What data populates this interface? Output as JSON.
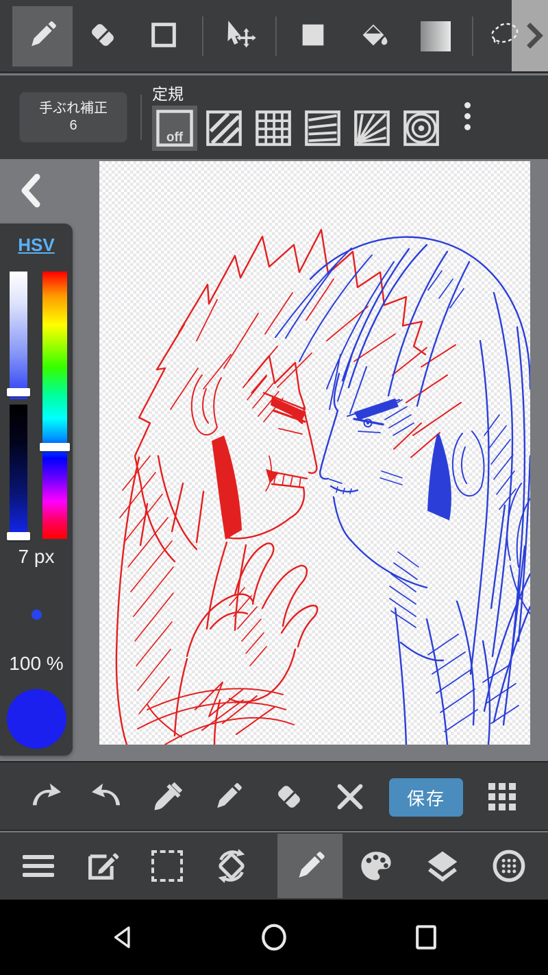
{
  "colors": {
    "toolbar_bg": "#3b3c3e",
    "workspace_bg": "#797a7e",
    "selected_tool_bg": "#5f6062",
    "icon": "#dcdcdc",
    "save_button": "#4a8cbd",
    "hsv_label_blue": "#5db2f5",
    "current_color": "#1b20ee",
    "sketch_red": "#e32020",
    "sketch_blue": "#2b3fd8"
  },
  "top_toolbar": {
    "tools": [
      "pen",
      "eraser",
      "shape-rectangle",
      "transform-move",
      "fill-rectangle",
      "bucket-fill",
      "gradient",
      "lasso"
    ],
    "selected_tool": "pen"
  },
  "ruler_row": {
    "stabilization_label": "手ぶれ補正",
    "stabilization_value": "6",
    "ruler_label": "定規",
    "ruler_off_label": "off",
    "rulers": [
      "off",
      "parallel-lines",
      "grid",
      "horizontal-lines",
      "radial-rays",
      "concentric-circles"
    ],
    "selected_ruler": "off"
  },
  "color_panel": {
    "mode_label": "HSV",
    "brush_size": "7 px",
    "opacity": "100 %"
  },
  "action_bar": {
    "icons": [
      "undo",
      "redo",
      "eyedropper",
      "pen",
      "eraser",
      "clear",
      "save",
      "menu-grid"
    ],
    "save_label": "保存"
  },
  "main_bar": {
    "icons": [
      "menu",
      "edit",
      "select",
      "rotate",
      "pen",
      "palette",
      "layers",
      "material"
    ],
    "selected": "pen"
  },
  "android_nav": {
    "icons": [
      "back",
      "home",
      "recents"
    ]
  },
  "canvas": {
    "content": "red and blue sketch of two characters facing each other on transparent checkerboard"
  }
}
